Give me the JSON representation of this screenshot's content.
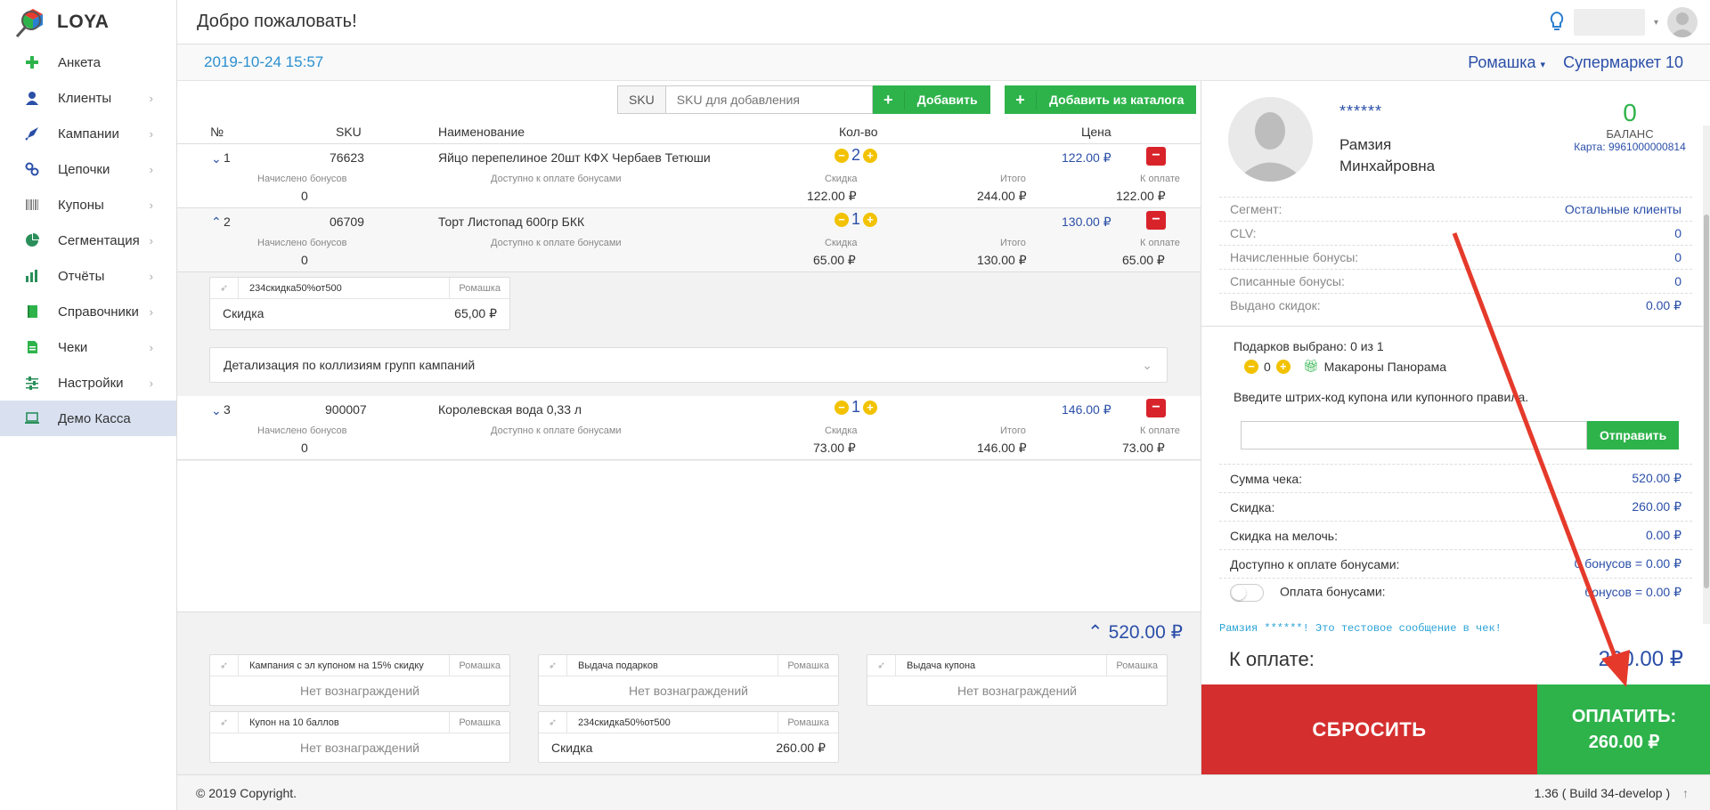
{
  "app": {
    "name": "LOYA"
  },
  "topbar": {
    "title": "Добро пожаловать!"
  },
  "sidebar": {
    "items": [
      {
        "label": "Анкета",
        "icon": "plus-icon",
        "chev": ""
      },
      {
        "label": "Клиенты",
        "icon": "user-icon",
        "chev": "›"
      },
      {
        "label": "Кампании",
        "icon": "rocket-icon",
        "chev": "›"
      },
      {
        "label": "Цепочки",
        "icon": "chain-icon",
        "chev": "›"
      },
      {
        "label": "Купоны",
        "icon": "barcode-icon",
        "chev": "›"
      },
      {
        "label": "Сегментация",
        "icon": "pie-icon",
        "chev": "›"
      },
      {
        "label": "Отчёты",
        "icon": "bar-chart-icon",
        "chev": "›"
      },
      {
        "label": "Справочники",
        "icon": "book-icon",
        "chev": "›"
      },
      {
        "label": "Чеки",
        "icon": "receipt-icon",
        "chev": "›"
      },
      {
        "label": "Настройки",
        "icon": "sliders-icon",
        "chev": "›"
      },
      {
        "label": "Демо Касса",
        "icon": "laptop-icon",
        "chev": ""
      }
    ]
  },
  "subbar": {
    "datetime": "2019-10-24 15:57",
    "store": "Ромашка",
    "market": "Супермаркет 10"
  },
  "toolbar": {
    "sku_label": "SKU",
    "sku_placeholder": "SKU для добавления",
    "add": "Добавить",
    "add_catalog": "Добавить из каталога"
  },
  "table": {
    "headers": {
      "num": "№",
      "sku": "SKU",
      "name": "Наименование",
      "qty": "Кол-во",
      "price": "Цена"
    },
    "sublabels": {
      "accrued": "Начислено бонусов",
      "avail": "Доступно к оплате бонусами",
      "discount": "Скидка",
      "total": "Итого",
      "topay": "К оплате"
    },
    "rows": [
      {
        "num": "1",
        "sku": "76623",
        "name": "Яйцо перепелиное 20шт КФХ Чербаев Тетюши",
        "qty": "2",
        "price": "122.00 ₽",
        "accrued": "0",
        "discount": "122.00 ₽",
        "total": "244.00 ₽",
        "topay": "122.00 ₽"
      },
      {
        "num": "2",
        "sku": "06709",
        "name": "Торт Листопад 600гр БКК",
        "qty": "1",
        "price": "130.00 ₽",
        "accrued": "0",
        "discount": "65.00 ₽",
        "total": "130.00 ₽",
        "topay": "65.00 ₽"
      },
      {
        "num": "3",
        "sku": "900007",
        "name": "Королевская вода 0,33 л",
        "qty": "1",
        "price": "146.00 ₽",
        "accrued": "0",
        "discount": "73.00 ₽",
        "total": "146.00 ₽",
        "topay": "73.00 ₽"
      }
    ]
  },
  "row2_card": {
    "name": "234скидка50%от500",
    "shop": "Ромашка",
    "label": "Скидка",
    "value": "65,00 ₽"
  },
  "collisions": {
    "label": "Детализация по коллизиям групп кампаний"
  },
  "total": {
    "value": "520.00 ₽"
  },
  "campaigns": [
    {
      "name": "Кампания с эл купоном на 15% скидку",
      "shop": "Ромашка",
      "body": "Нет вознаграждений"
    },
    {
      "name": "Выдача подарков",
      "shop": "Ромашка",
      "body": "Нет вознаграждений"
    },
    {
      "name": "Выдача купона",
      "shop": "Ромашка",
      "body": "Нет вознаграждений"
    },
    {
      "name": "Купон на 10 баллов",
      "shop": "Ромашка",
      "body": "Нет вознаграждений"
    },
    {
      "name": "234скидка50%от500",
      "shop": "Ромашка",
      "label": "Скидка",
      "value": "260.00 ₽"
    }
  ],
  "client": {
    "stars": "******",
    "name1": "Рамзия",
    "name2": "Минхайровна",
    "balance": "0",
    "balance_label": "БАЛАНС",
    "card": "Карта: 9961000000814",
    "stats": [
      {
        "k": "Сегмент:",
        "v": "Остальные клиенты"
      },
      {
        "k": "CLV:",
        "v": "0"
      },
      {
        "k": "Начисленные бонусы:",
        "v": "0"
      },
      {
        "k": "Списанные бонусы:",
        "v": "0"
      },
      {
        "k": "Выдано скидок:",
        "v": "0.00 ₽"
      }
    ]
  },
  "gifts": {
    "selected": "Подарков выбрано: 0 из 1",
    "qty": "0",
    "item": "Макароны Панорама"
  },
  "coupon": {
    "prompt": "Введите штрих-код купона или купонного правила.",
    "send": "Отправить"
  },
  "sums": [
    {
      "k": "Сумма чека:",
      "v": "520.00 ₽"
    },
    {
      "k": "Скидка:",
      "v": "260.00 ₽"
    },
    {
      "k": "Скидка на мелочь:",
      "v": "0.00 ₽"
    },
    {
      "k": "Доступно к оплате бонусами:",
      "v": "0 бонусов = 0.00 ₽"
    }
  ],
  "bonus_pay": {
    "label": "Оплата бонусами:",
    "v": "бонусов = 0.00 ₽"
  },
  "message": "Рамзия ******! Это тестовое сообщение в чек!",
  "to_pay": {
    "label": "К оплате:",
    "value": "260.00 ₽"
  },
  "buttons": {
    "reset": "СБРОСИТЬ",
    "pay1": "ОПЛАТИТЬ:",
    "pay2": "260.00 ₽"
  },
  "footer": {
    "copyright": "© 2019 Copyright.",
    "version": "1.36 ( Build 34-develop )"
  }
}
